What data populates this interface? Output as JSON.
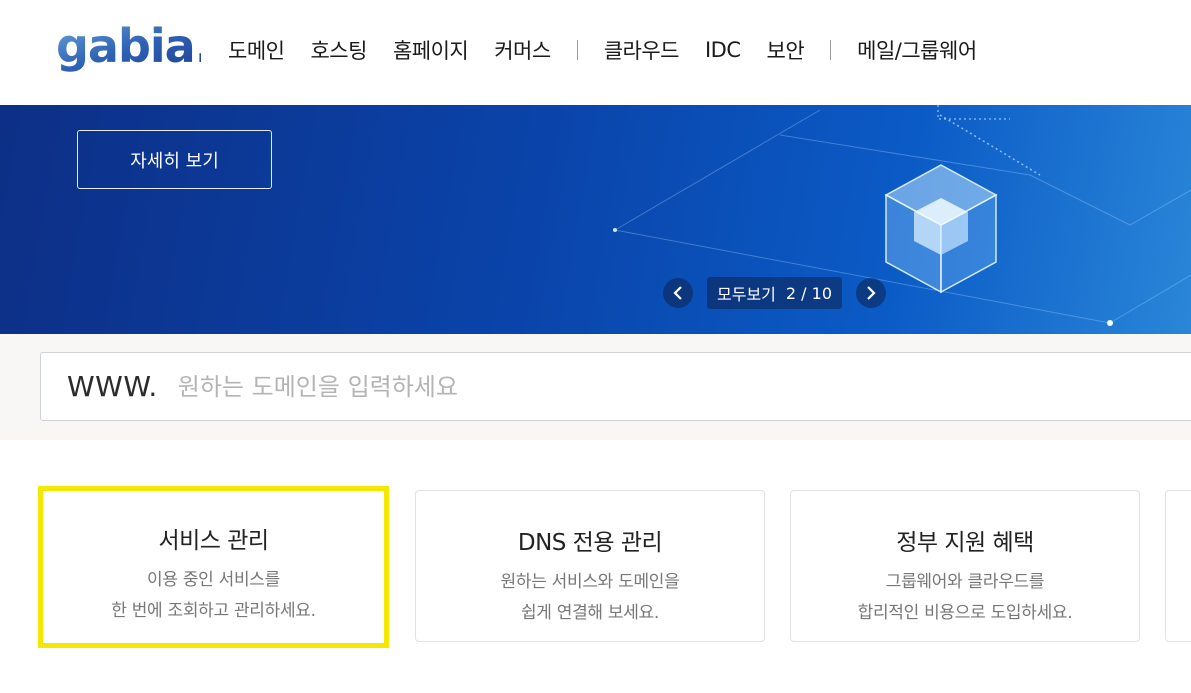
{
  "header": {
    "logo_text": "gabia.",
    "nav": {
      "domain": "도메인",
      "hosting": "호스팅",
      "homepage": "홈페이지",
      "commerce": "커머스",
      "cloud": "클라우드",
      "idc": "IDC",
      "security": "보안",
      "mail": "메일/그룹웨어"
    }
  },
  "banner": {
    "detail_button": "자세히 보기",
    "pager": {
      "view_all": "모두보기",
      "count": "2 / 10"
    }
  },
  "search": {
    "prefix": "WWW.",
    "placeholder": "원하는 도메인을 입력하세요"
  },
  "cards": [
    {
      "title": "서비스 관리",
      "line1": "이용 중인 서비스를",
      "line2": "한 번에 조회하고 관리하세요."
    },
    {
      "title": "DNS 전용 관리",
      "line1": "원하는 서비스와 도메인을",
      "line2": "쉽게 연결해 보세요."
    },
    {
      "title": "정부 지원 혜택",
      "line1": "그룹웨어와 클라우드를",
      "line2": "합리적인 비용으로 도입하세요."
    }
  ],
  "colors": {
    "brand": "#1f4fa8",
    "highlight": "#f5e800"
  }
}
